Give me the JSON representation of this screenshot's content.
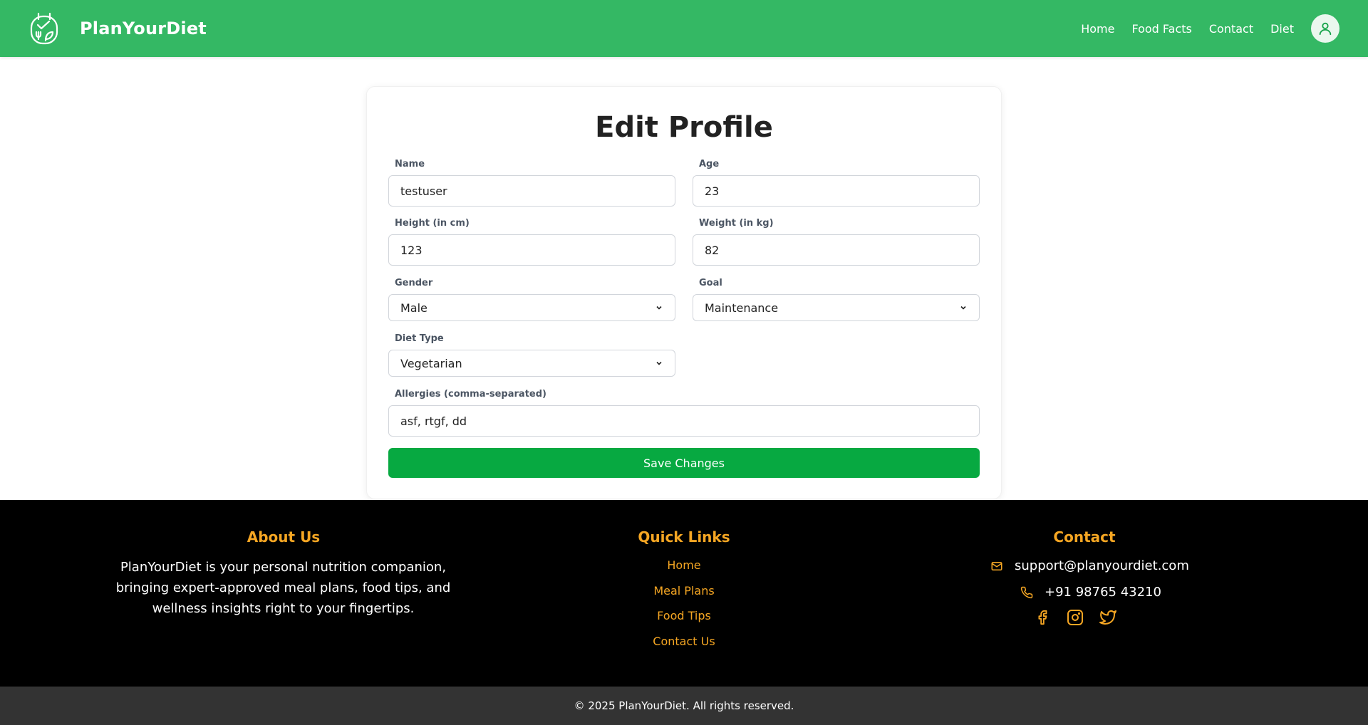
{
  "header": {
    "brand": "PlanYourDiet",
    "nav": [
      "Home",
      "Food Facts",
      "Contact",
      "Diet"
    ],
    "accent_color": "#34b864"
  },
  "form": {
    "title": "Edit Profile",
    "name": {
      "label": "Name",
      "value": "testuser"
    },
    "age": {
      "label": "Age",
      "value": "23"
    },
    "height": {
      "label": "Height (in cm)",
      "value": "123"
    },
    "weight": {
      "label": "Weight (in kg)",
      "value": "82"
    },
    "gender": {
      "label": "Gender",
      "value": "Male"
    },
    "goal": {
      "label": "Goal",
      "value": "Maintenance"
    },
    "diet_type": {
      "label": "Diet Type",
      "value": "Vegetarian"
    },
    "allergies": {
      "label": "Allergies (comma-separated)",
      "value": "asf, rtgf, dd"
    },
    "save_label": "Save Changes",
    "button_color": "#07a941"
  },
  "footer": {
    "about": {
      "title": "About Us",
      "text": "PlanYourDiet is your personal nutrition companion, bringing expert-approved meal plans, food tips, and wellness insights right to your fingertips."
    },
    "quick_links": {
      "title": "Quick Links",
      "items": [
        "Home",
        "Meal Plans",
        "Food Tips",
        "Contact Us"
      ]
    },
    "contact": {
      "title": "Contact",
      "email": "support@planyourdiet.com",
      "phone": "+91 98765 43210"
    },
    "social_icons": [
      "facebook-icon",
      "instagram-icon",
      "twitter-icon"
    ],
    "heading_color": "#f5a623",
    "copyright": "© 2025 PlanYourDiet. All rights reserved."
  }
}
